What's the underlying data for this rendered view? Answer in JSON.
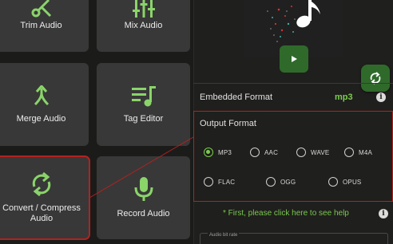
{
  "tools": {
    "trim": {
      "label": "Trim Audio",
      "icon": "scissors-icon"
    },
    "mix": {
      "label": "Mix Audio",
      "icon": "sliders-icon"
    },
    "merge": {
      "label": "Merge Audio",
      "icon": "merge-icon"
    },
    "tag": {
      "label": "Tag Editor",
      "icon": "tag-list-icon"
    },
    "convert": {
      "label_line1": "Convert / Compress",
      "label_line2": "Audio",
      "icon": "convert-cycle-icon"
    },
    "record": {
      "label": "Record Audio",
      "icon": "microphone-icon"
    }
  },
  "embedded": {
    "label": "Embedded Format",
    "value": "mp3"
  },
  "output": {
    "title": "Output Format",
    "selected": "MP3",
    "options": [
      "MP3",
      "AAC",
      "WAVE",
      "M4A",
      "FLAC",
      "OGG",
      "OPUS"
    ]
  },
  "help": {
    "text": "* First, please click here to see help"
  },
  "bitrate": {
    "label": "Audio bit rate"
  },
  "colors": {
    "accent": "#7ccc4f",
    "highlight": "#b3221f",
    "button": "#2f6a2b",
    "tile": "#383838"
  }
}
